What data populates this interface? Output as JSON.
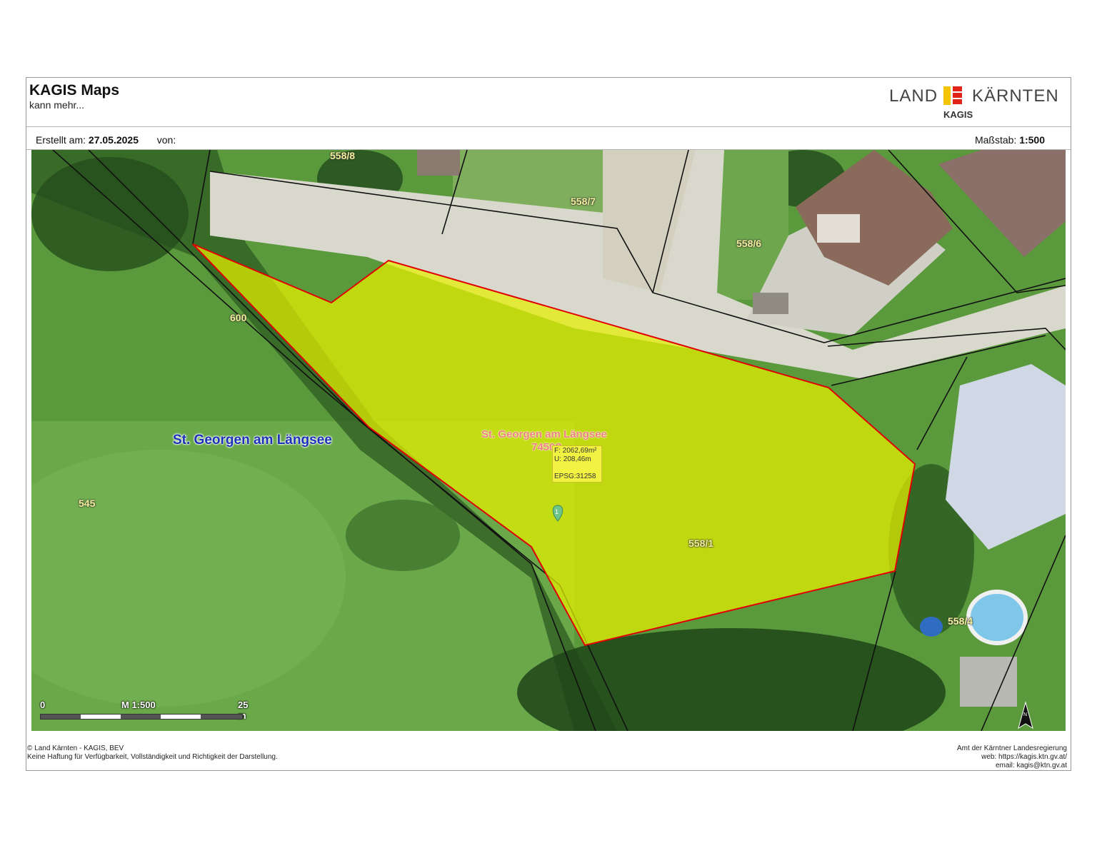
{
  "header": {
    "title": "KAGIS Maps",
    "subtitle": "kann mehr...",
    "logo": {
      "land": "LAND",
      "kaernten": "KÄRNTEN",
      "kagis": "KAGIS",
      "colors": [
        "#f5c400",
        "#e2231a"
      ]
    }
  },
  "meta": {
    "created_label": "Erstellt am:",
    "created_value": "27.05.2025",
    "by_label": "von:",
    "scale_label": "Maßstab:",
    "scale_value": "1:500"
  },
  "map": {
    "parcels": [
      "558/8",
      "558/7",
      "558/6",
      "600",
      "545",
      "558/1",
      "558/4"
    ],
    "place_name": "St. Georgen am Längsee",
    "highlight": {
      "place_name": "St. Georgen am Längsee",
      "code": "7450?",
      "area": "F: 2062,69m²",
      "perimeter": "U: 208,46m",
      "epsg": "EPSG:31258",
      "fill_color": "#e6f000",
      "stroke_color": "#e00000"
    },
    "marker_label": "1",
    "scale_bar": {
      "start": "0",
      "label": "M 1:500",
      "end": "25 m"
    },
    "north_arrow": "N"
  },
  "footer": {
    "copyright": "© Land Kärnten - KAGIS, BEV",
    "disclaimer": "Keine Haftung für Verfügbarkeit, Vollständigkeit und Richtigkeit der Darstellung.",
    "agency": "Amt der Kärntner Landesregierung",
    "web": "web: https://kagis.ktn.gv.at/",
    "email": "email: kagis@ktn.gv.at"
  }
}
